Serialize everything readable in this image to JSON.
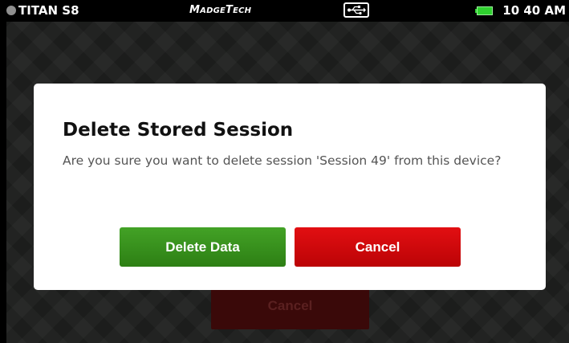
{
  "status_bar": {
    "device_name": "TITAN S8",
    "brand": {
      "first_cap": "M",
      "first_rest": "ADGE",
      "second_cap": "T",
      "second_rest": "ECH"
    },
    "usb_icon": "usb-icon",
    "battery_icon": "battery-icon",
    "battery_color": "#2fd12f",
    "time": "10 40 AM"
  },
  "background": {
    "cancel_label": "Cancel"
  },
  "dialog": {
    "title": "Delete Stored Session",
    "message": "Are you sure you want to delete session 'Session 49' from this device?",
    "delete_label": "Delete Data",
    "cancel_label": "Cancel",
    "delete_color": "#369116",
    "cancel_color": "#d0080b"
  }
}
